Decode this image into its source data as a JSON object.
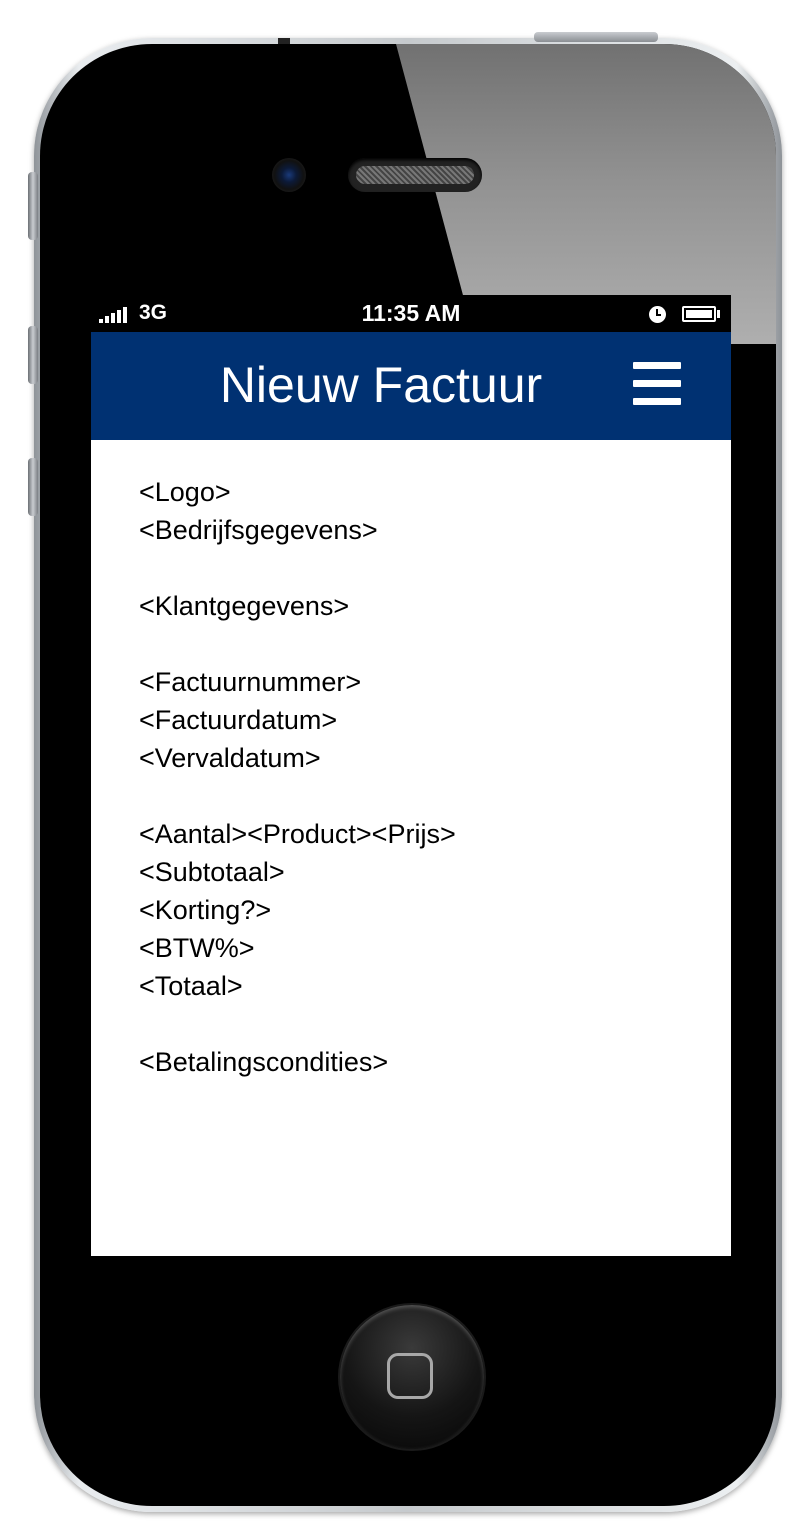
{
  "status_bar": {
    "network": "3G",
    "time": "11:35 AM"
  },
  "header": {
    "title": "Nieuw Factuur",
    "background_color": "#003172",
    "menu_icon": "hamburger-menu-icon"
  },
  "invoice_template": {
    "sections": [
      [
        "<Logo>",
        "<Bedrijfsgegevens>"
      ],
      [
        "<Klantgegevens>"
      ],
      [
        "<Factuurnummer>",
        "<Factuurdatum>",
        "<Vervaldatum>"
      ],
      [
        "<Aantal><Product><Prijs>",
        "<Subtotaal>",
        "<Korting?>",
        "<BTW%>",
        "<Totaal>"
      ],
      [
        "<Betalingscondities>"
      ]
    ]
  }
}
